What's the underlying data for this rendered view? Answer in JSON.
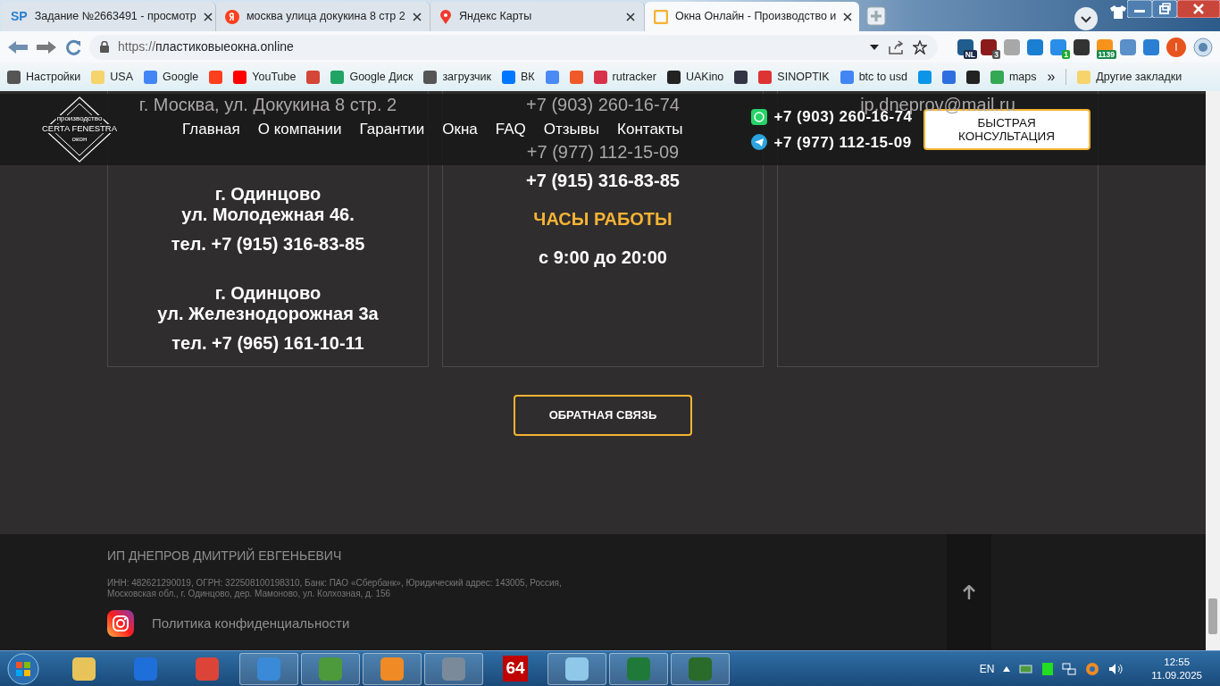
{
  "browser": {
    "tabs": [
      {
        "favicon_text": "SP",
        "title": "Задание №2663491 - просмотр",
        "selected": false
      },
      {
        "title": "москва улица докукина 8 стр 2",
        "selected": false
      },
      {
        "title": "Яндекс Карты",
        "selected": false
      },
      {
        "title": "Окна Онлайн - Производство и",
        "selected": true
      }
    ],
    "address": {
      "scheme": "https://",
      "host": "пластиковыеокна.online"
    },
    "extensions": [
      {
        "color": "#1f5d8c",
        "badge": "NL"
      },
      {
        "color": "#8b1a1a",
        "badge": "3"
      },
      {
        "color": "#a8a8a8"
      },
      {
        "color": "#1b7fd1"
      },
      {
        "color": "#2a8ee8",
        "badge": "1"
      },
      {
        "color": "#333333"
      },
      {
        "color": "#f7931a",
        "badge": "1139"
      },
      {
        "color": "#5b8fc7"
      },
      {
        "color": "#2a7fd4"
      }
    ],
    "profile": {
      "initial": "I"
    },
    "bookmarks": [
      {
        "label": "Настройки",
        "color": "#555555"
      },
      {
        "label": "USA",
        "color": "#f6d36b"
      },
      {
        "label": "Google",
        "color": "#4285f4"
      },
      {
        "color": "#fc3f1d"
      },
      {
        "label": "YouTube",
        "color": "#ff0000"
      },
      {
        "color": "#d44638"
      },
      {
        "label": "Google Диск",
        "color": "#1fa463"
      },
      {
        "label": "загрузчик",
        "color": "#555555"
      },
      {
        "label": "ВК",
        "color": "#0077ff"
      },
      {
        "color": "#4a8af4"
      },
      {
        "color": "#f05a28"
      },
      {
        "label": "rutracker",
        "color": "#d8324a"
      },
      {
        "label": "UAKino",
        "color": "#222222"
      },
      {
        "color": "#333344"
      },
      {
        "label": "SINOPTIK",
        "color": "#dd3333"
      },
      {
        "label": "btc to usd",
        "color": "#4285f4"
      },
      {
        "color": "#0a95e8"
      },
      {
        "color": "#2d6fe0"
      },
      {
        "color": "#222222"
      },
      {
        "label": "maps",
        "color": "#34a853"
      }
    ],
    "bookmarks_more": "»",
    "other_bookmarks": "Другие закладки"
  },
  "site": {
    "logo": {
      "top": "производство",
      "name": "CERTA FENESTRA",
      "bottom": "окон"
    },
    "nav": [
      "Главная",
      "О компании",
      "Гарантии",
      "Окна",
      "FAQ",
      "Отзывы",
      "Контакты"
    ],
    "phones": [
      {
        "kind": "whatsapp",
        "number": "+7 (903) 260-16-74"
      },
      {
        "kind": "telegram",
        "number": "+7 (977) 112-15-09"
      }
    ],
    "consult_button": "БЫСТРАЯ КОНСУЛЬТАЦИЯ",
    "cards": [
      {
        "lines": [
          {
            "kind": "hidden",
            "text": "г. Москва, ул. Докукина 8 стр. 2"
          },
          {
            "kind": "address",
            "text": "г. Одинцово"
          },
          {
            "kind": "address",
            "text": "ул. Молодежная 46."
          },
          {
            "kind": "phone",
            "text": "тел. +7 (915) 316-83-85"
          },
          {
            "kind": "address",
            "text": "г. Одинцово"
          },
          {
            "kind": "address",
            "text": "ул. Железнодорожная 3а"
          },
          {
            "kind": "phone",
            "text": "тел. +7 (965) 161-10-11"
          }
        ]
      },
      {
        "lines": [
          {
            "kind": "hidden",
            "text": "+7 (903) 260-16-74"
          },
          {
            "kind": "hidden",
            "text": "+7 (977) 112-15-09"
          },
          {
            "kind": "phone",
            "text": "+7 (915) 316-83-85"
          },
          {
            "kind": "heading",
            "text": "ЧАСЫ РАБОТЫ"
          },
          {
            "kind": "phone",
            "text": "с 9:00 до 20:00"
          }
        ]
      },
      {
        "lines": [
          {
            "kind": "hidden",
            "text": "ip.dneprov@mail.ru"
          }
        ]
      }
    ],
    "feedback_button": "ОБРАТНАЯ СВЯЗЬ",
    "footer": {
      "owner": "ИП ДНЕПРОВ ДМИТРИЙ ЕВГЕНЬЕВИЧ",
      "legal": "ИНН: 482621290019, ОГРН: 322508100198310, Банк: ПАО «Сбербанк», Юридический адрес: 143005, Россия, Московская обл., г. Одинцово, дер. Мамоново, ул. Колхозная, д. 156",
      "privacy": "Политика конфиденциальности"
    }
  },
  "taskbar": {
    "apps": [
      {
        "color": "#e8c35a",
        "active": false
      },
      {
        "color": "#1e6fd9",
        "active": false
      },
      {
        "color": "#db4437",
        "active": false
      },
      {
        "color": "#3a8ad8",
        "active": true
      },
      {
        "color": "#4c9a3c",
        "active": true
      },
      {
        "color": "#f08a24",
        "active": true
      },
      {
        "color": "#7a8a9a",
        "active": true
      },
      {
        "color": "#c00000",
        "text": "64",
        "active": false
      },
      {
        "color": "#8fc8e8",
        "active": true
      },
      {
        "color": "#1f7a3a",
        "active": true
      },
      {
        "color": "#2a6a2a",
        "active": true
      }
    ],
    "lang": "EN",
    "time": "12:55",
    "date": "11.09.2025"
  }
}
